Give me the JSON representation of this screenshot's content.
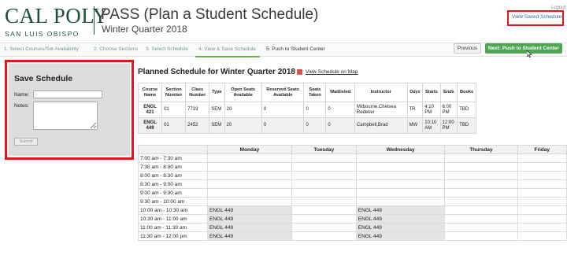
{
  "header": {
    "logo_main": "CAL POLY",
    "logo_sub": "SAN LUIS OBISPO",
    "title": "PASS (Plan a Student Schedule)",
    "subtitle": "Winter Quarter 2018",
    "logout_label": "Logout",
    "view_saved_label": "View Saved Schedules"
  },
  "steps": [
    {
      "label": "1. Select Courses/Set Availability"
    },
    {
      "label": "2. Choose Sections"
    },
    {
      "label": "3. Select Schedule"
    },
    {
      "label": "4. View & Save Schedule"
    },
    {
      "label": "5. Push to Student Center"
    }
  ],
  "nav": {
    "previous_label": "Previous",
    "next_label": "Next: Push to Student Center"
  },
  "save_panel": {
    "title": "Save Schedule",
    "name_label": "Name:",
    "notes_label": "Notes:",
    "name_value": "",
    "notes_value": "",
    "submit_label": "Submit"
  },
  "planned": {
    "title": "Planned Schedule for Winter Quarter 2018",
    "map_link": "View Schedule on Map"
  },
  "course_table": {
    "headers": [
      "Course Name",
      "Section Number",
      "Class Number",
      "Type",
      "Open Seats Available",
      "Reserved Seats Available",
      "Seats Taken",
      "Waitlisted",
      "Instructor",
      "Days",
      "Starts",
      "Ends",
      "Books"
    ],
    "rows": [
      [
        "ENGL 421",
        "01",
        "7719",
        "SEM",
        "20",
        "0",
        "0",
        "0",
        "Milbourne,Chelsea Redeker",
        "TR",
        "4:10 PM",
        "6:00 PM",
        "TBD"
      ],
      [
        "ENGL 449",
        "01",
        "2452",
        "SEM",
        "20",
        "0",
        "0",
        "0",
        "Campbell,Brad",
        "MW",
        "10:10 AM",
        "12:00 PM",
        "TBD"
      ]
    ]
  },
  "week_table": {
    "headers": [
      "",
      "Monday",
      "Tuesday",
      "Wednesday",
      "Thursday",
      "Friday"
    ],
    "rows": [
      {
        "time": "7:00 am - 7:30 am",
        "cells": [
          "",
          "",
          "",
          "",
          ""
        ]
      },
      {
        "time": "7:30 am - 8:00 am",
        "cells": [
          "",
          "",
          "",
          "",
          ""
        ]
      },
      {
        "time": "8:00 am - 8:30 am",
        "cells": [
          "",
          "",
          "",
          "",
          ""
        ]
      },
      {
        "time": "8:30 am - 9:00 am",
        "cells": [
          "",
          "",
          "",
          "",
          ""
        ]
      },
      {
        "time": "9:00 am - 9:30 am",
        "cells": [
          "",
          "",
          "",
          "",
          ""
        ]
      },
      {
        "time": "9:30 am - 10:00 am",
        "cells": [
          "",
          "",
          "",
          "",
          ""
        ]
      },
      {
        "time": "10:00 am - 10:30 am",
        "cells": [
          "ENGL 449",
          "",
          "ENGL 449",
          "",
          ""
        ]
      },
      {
        "time": "10:30 am - 11:00 am",
        "cells": [
          "ENGL 449",
          "",
          "ENGL 449",
          "",
          ""
        ]
      },
      {
        "time": "11:00 am - 11:30 am",
        "cells": [
          "ENGL 449",
          "",
          "ENGL 449",
          "",
          ""
        ]
      },
      {
        "time": "11:30 am - 12:00 pm",
        "cells": [
          "ENGL 449",
          "",
          "ENGL 449",
          "",
          ""
        ]
      }
    ]
  },
  "colors": {
    "brand_green": "#1e5236",
    "next_button": "#4ea651",
    "highlight_red": "#e8141b",
    "link_blue": "#3567a8"
  },
  "icons": {
    "map": "map-icon",
    "cursor": "cursor-icon"
  }
}
